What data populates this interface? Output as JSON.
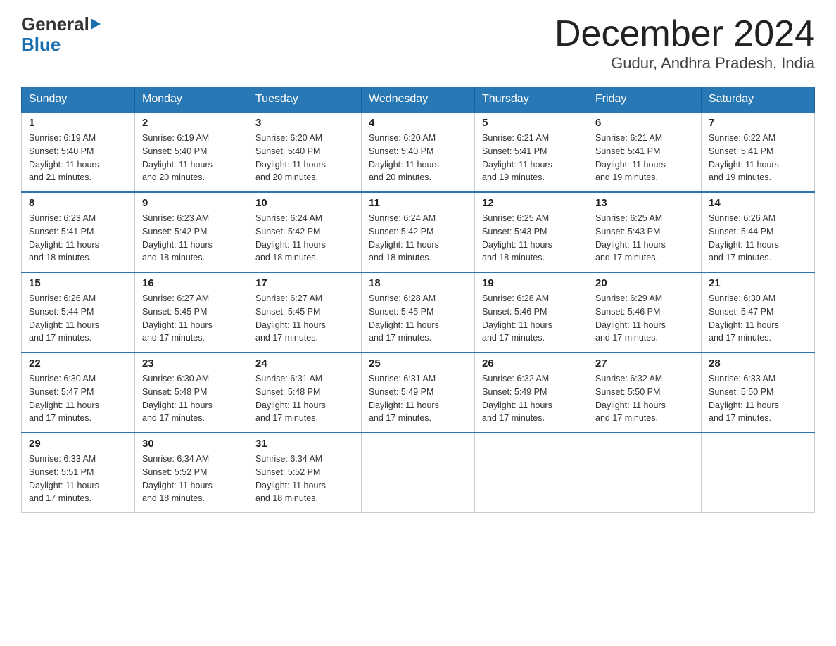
{
  "logo": {
    "general": "General",
    "blue": "Blue",
    "alt": "GeneralBlue logo"
  },
  "title": "December 2024",
  "subtitle": "Gudur, Andhra Pradesh, India",
  "days_of_week": [
    "Sunday",
    "Monday",
    "Tuesday",
    "Wednesday",
    "Thursday",
    "Friday",
    "Saturday"
  ],
  "weeks": [
    [
      {
        "day": "1",
        "sunrise": "Sunrise: 6:19 AM",
        "sunset": "Sunset: 5:40 PM",
        "daylight": "Daylight: 11 hours and 21 minutes."
      },
      {
        "day": "2",
        "sunrise": "Sunrise: 6:19 AM",
        "sunset": "Sunset: 5:40 PM",
        "daylight": "Daylight: 11 hours and 20 minutes."
      },
      {
        "day": "3",
        "sunrise": "Sunrise: 6:20 AM",
        "sunset": "Sunset: 5:40 PM",
        "daylight": "Daylight: 11 hours and 20 minutes."
      },
      {
        "day": "4",
        "sunrise": "Sunrise: 6:20 AM",
        "sunset": "Sunset: 5:40 PM",
        "daylight": "Daylight: 11 hours and 20 minutes."
      },
      {
        "day": "5",
        "sunrise": "Sunrise: 6:21 AM",
        "sunset": "Sunset: 5:41 PM",
        "daylight": "Daylight: 11 hours and 19 minutes."
      },
      {
        "day": "6",
        "sunrise": "Sunrise: 6:21 AM",
        "sunset": "Sunset: 5:41 PM",
        "daylight": "Daylight: 11 hours and 19 minutes."
      },
      {
        "day": "7",
        "sunrise": "Sunrise: 6:22 AM",
        "sunset": "Sunset: 5:41 PM",
        "daylight": "Daylight: 11 hours and 19 minutes."
      }
    ],
    [
      {
        "day": "8",
        "sunrise": "Sunrise: 6:23 AM",
        "sunset": "Sunset: 5:41 PM",
        "daylight": "Daylight: 11 hours and 18 minutes."
      },
      {
        "day": "9",
        "sunrise": "Sunrise: 6:23 AM",
        "sunset": "Sunset: 5:42 PM",
        "daylight": "Daylight: 11 hours and 18 minutes."
      },
      {
        "day": "10",
        "sunrise": "Sunrise: 6:24 AM",
        "sunset": "Sunset: 5:42 PM",
        "daylight": "Daylight: 11 hours and 18 minutes."
      },
      {
        "day": "11",
        "sunrise": "Sunrise: 6:24 AM",
        "sunset": "Sunset: 5:42 PM",
        "daylight": "Daylight: 11 hours and 18 minutes."
      },
      {
        "day": "12",
        "sunrise": "Sunrise: 6:25 AM",
        "sunset": "Sunset: 5:43 PM",
        "daylight": "Daylight: 11 hours and 18 minutes."
      },
      {
        "day": "13",
        "sunrise": "Sunrise: 6:25 AM",
        "sunset": "Sunset: 5:43 PM",
        "daylight": "Daylight: 11 hours and 17 minutes."
      },
      {
        "day": "14",
        "sunrise": "Sunrise: 6:26 AM",
        "sunset": "Sunset: 5:44 PM",
        "daylight": "Daylight: 11 hours and 17 minutes."
      }
    ],
    [
      {
        "day": "15",
        "sunrise": "Sunrise: 6:26 AM",
        "sunset": "Sunset: 5:44 PM",
        "daylight": "Daylight: 11 hours and 17 minutes."
      },
      {
        "day": "16",
        "sunrise": "Sunrise: 6:27 AM",
        "sunset": "Sunset: 5:45 PM",
        "daylight": "Daylight: 11 hours and 17 minutes."
      },
      {
        "day": "17",
        "sunrise": "Sunrise: 6:27 AM",
        "sunset": "Sunset: 5:45 PM",
        "daylight": "Daylight: 11 hours and 17 minutes."
      },
      {
        "day": "18",
        "sunrise": "Sunrise: 6:28 AM",
        "sunset": "Sunset: 5:45 PM",
        "daylight": "Daylight: 11 hours and 17 minutes."
      },
      {
        "day": "19",
        "sunrise": "Sunrise: 6:28 AM",
        "sunset": "Sunset: 5:46 PM",
        "daylight": "Daylight: 11 hours and 17 minutes."
      },
      {
        "day": "20",
        "sunrise": "Sunrise: 6:29 AM",
        "sunset": "Sunset: 5:46 PM",
        "daylight": "Daylight: 11 hours and 17 minutes."
      },
      {
        "day": "21",
        "sunrise": "Sunrise: 6:30 AM",
        "sunset": "Sunset: 5:47 PM",
        "daylight": "Daylight: 11 hours and 17 minutes."
      }
    ],
    [
      {
        "day": "22",
        "sunrise": "Sunrise: 6:30 AM",
        "sunset": "Sunset: 5:47 PM",
        "daylight": "Daylight: 11 hours and 17 minutes."
      },
      {
        "day": "23",
        "sunrise": "Sunrise: 6:30 AM",
        "sunset": "Sunset: 5:48 PM",
        "daylight": "Daylight: 11 hours and 17 minutes."
      },
      {
        "day": "24",
        "sunrise": "Sunrise: 6:31 AM",
        "sunset": "Sunset: 5:48 PM",
        "daylight": "Daylight: 11 hours and 17 minutes."
      },
      {
        "day": "25",
        "sunrise": "Sunrise: 6:31 AM",
        "sunset": "Sunset: 5:49 PM",
        "daylight": "Daylight: 11 hours and 17 minutes."
      },
      {
        "day": "26",
        "sunrise": "Sunrise: 6:32 AM",
        "sunset": "Sunset: 5:49 PM",
        "daylight": "Daylight: 11 hours and 17 minutes."
      },
      {
        "day": "27",
        "sunrise": "Sunrise: 6:32 AM",
        "sunset": "Sunset: 5:50 PM",
        "daylight": "Daylight: 11 hours and 17 minutes."
      },
      {
        "day": "28",
        "sunrise": "Sunrise: 6:33 AM",
        "sunset": "Sunset: 5:50 PM",
        "daylight": "Daylight: 11 hours and 17 minutes."
      }
    ],
    [
      {
        "day": "29",
        "sunrise": "Sunrise: 6:33 AM",
        "sunset": "Sunset: 5:51 PM",
        "daylight": "Daylight: 11 hours and 17 minutes."
      },
      {
        "day": "30",
        "sunrise": "Sunrise: 6:34 AM",
        "sunset": "Sunset: 5:52 PM",
        "daylight": "Daylight: 11 hours and 18 minutes."
      },
      {
        "day": "31",
        "sunrise": "Sunrise: 6:34 AM",
        "sunset": "Sunset: 5:52 PM",
        "daylight": "Daylight: 11 hours and 18 minutes."
      },
      null,
      null,
      null,
      null
    ]
  ]
}
